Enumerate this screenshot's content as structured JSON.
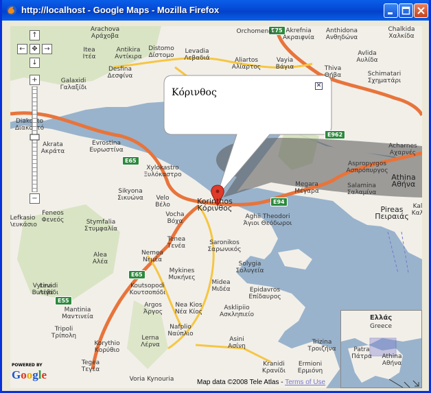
{
  "window": {
    "title": "http://localhost - Google Maps - Mozilla Firefox"
  },
  "colors": {
    "title_bar": "#0a5fe8",
    "sea": "#99b3cc",
    "land": "#f2efe9",
    "green_land": "#cfe0b4",
    "motorway": "#e8743b",
    "primary_road": "#f6c642",
    "shield": "#2c8a3c"
  },
  "map": {
    "controls": {
      "pan_up": "↑",
      "pan_left": "←",
      "pan_center": "✥",
      "pan_right": "→",
      "pan_down": "↓",
      "zoom_in": "+",
      "zoom_out": "−"
    },
    "info_window": {
      "text": "Κόρινθος",
      "close": "✕"
    },
    "marker": "Κόρινθος",
    "shields": [
      "E75",
      "E962",
      "E65",
      "E94",
      "E65",
      "E55"
    ],
    "labels": [
      {
        "lat": "Arachova",
        "gr": "Αράχοβα"
      },
      {
        "lat": "Orchomenos",
        "gr": ""
      },
      {
        "lat": "Akrefnia",
        "gr": "Ακραιφνία"
      },
      {
        "lat": "Anthidona",
        "gr": "Ανθηδώνα"
      },
      {
        "lat": "Chalkida",
        "gr": "Χαλκίδα"
      },
      {
        "lat": "Itea",
        "gr": "Ιτέα"
      },
      {
        "lat": "Antikira",
        "gr": "Αντίκιρα"
      },
      {
        "lat": "Distomo",
        "gr": "Δίστομο"
      },
      {
        "lat": "Levadia",
        "gr": "Λεβαδιά"
      },
      {
        "lat": "Aliartos",
        "gr": "Αλίαρτος"
      },
      {
        "lat": "Vayia",
        "gr": "Βάγια"
      },
      {
        "lat": "Avlida",
        "gr": "Αυλίδα"
      },
      {
        "lat": "Desfina",
        "gr": "Δεσφίνα"
      },
      {
        "lat": "Thiva",
        "gr": "Θήβα"
      },
      {
        "lat": "Schimatari",
        "gr": "Σχηματάρι"
      },
      {
        "lat": "Galaxidi",
        "gr": "Γαλαξίδι"
      },
      {
        "lat": "Diakopto",
        "gr": "Διακοπτό"
      },
      {
        "lat": "Akrata",
        "gr": "Ακράτα"
      },
      {
        "lat": "Evrostina",
        "gr": "Ευρωστίνα"
      },
      {
        "lat": "Acharnes",
        "gr": "Αχαρνές"
      },
      {
        "lat": "Xylokastro",
        "gr": "Ξυλόκαστρο"
      },
      {
        "lat": "Aspropyrgos",
        "gr": "Ασπρόπυργος"
      },
      {
        "lat": "Sikyona",
        "gr": "Σικυώνα"
      },
      {
        "lat": "Megara",
        "gr": "Μέγαρα"
      },
      {
        "lat": "Salamina",
        "gr": "Σαλαμίνα"
      },
      {
        "lat": "Athina",
        "gr": "Αθήνα"
      },
      {
        "lat": "Velo",
        "gr": "Βέλο"
      },
      {
        "lat": "Korinthos",
        "gr": "Κόρινθος"
      },
      {
        "lat": "Pireas",
        "gr": "Πειραιάς"
      },
      {
        "lat": "Kalli",
        "gr": "Καλλ"
      },
      {
        "lat": "Lefkasio",
        "gr": "Λευκάσιο"
      },
      {
        "lat": "Feneos",
        "gr": "Φενεός"
      },
      {
        "lat": "Vocha",
        "gr": "Βόχα"
      },
      {
        "lat": "Aghii Theodori",
        "gr": "Άγιοι Θεόδωροι"
      },
      {
        "lat": "Stymfalia",
        "gr": "Στυμφαλία"
      },
      {
        "lat": "Tenea",
        "gr": "Τενέα"
      },
      {
        "lat": "Saronikos",
        "gr": "Σαρωνικός"
      },
      {
        "lat": "Nemea",
        "gr": "Νεμέα"
      },
      {
        "lat": "Alea",
        "gr": "Αλέα"
      },
      {
        "lat": "Solygia",
        "gr": "Σολυγεία"
      },
      {
        "lat": "Mykines",
        "gr": "Μυκήνες"
      },
      {
        "lat": "Midea",
        "gr": "Μιδέα"
      },
      {
        "lat": "Vytina",
        "gr": "Βυτίνα"
      },
      {
        "lat": "Levidi",
        "gr": "Λεβίδι"
      },
      {
        "lat": "Koutsopodi",
        "gr": "Κουτσοπόδι"
      },
      {
        "lat": "Epidavros",
        "gr": "Επίδαυρος"
      },
      {
        "lat": "Argos",
        "gr": "Άργος"
      },
      {
        "lat": "Nea Kios",
        "gr": "Νέα Κίος"
      },
      {
        "lat": "Asklipiio",
        "gr": "Ασκληπιείο"
      },
      {
        "lat": "Mantinia",
        "gr": "Μαντινεία"
      },
      {
        "lat": "Nafplio",
        "gr": "Ναύπλιο"
      },
      {
        "lat": "Tripoli",
        "gr": "Τρίπολη"
      },
      {
        "lat": "Lerna",
        "gr": "Λέρνα"
      },
      {
        "lat": "Asini",
        "gr": "Ασίνη"
      },
      {
        "lat": "Trizina",
        "gr": "Τροιζήνα"
      },
      {
        "lat": "Korythio",
        "gr": "Κορύθιο"
      },
      {
        "lat": "Tegea",
        "gr": "Τεγέα"
      },
      {
        "lat": "Kranidi",
        "gr": "Κρανίδι"
      },
      {
        "lat": "Ermioni",
        "gr": "Ερμιόνη"
      },
      {
        "lat": "Voria Kynouria",
        "gr": ""
      }
    ],
    "overview": {
      "title": "Ελλάς",
      "subtitle": "Greece",
      "city1": "Patra",
      "city1_gr": "Πάτρα",
      "city2": "Athina",
      "city2_gr": "Αθήνα"
    },
    "copyright": "Map data ©2008 Tele Atlas - ",
    "terms_link": "Terms of Use",
    "powered_by": "POWERED BY",
    "logo": "Google"
  }
}
